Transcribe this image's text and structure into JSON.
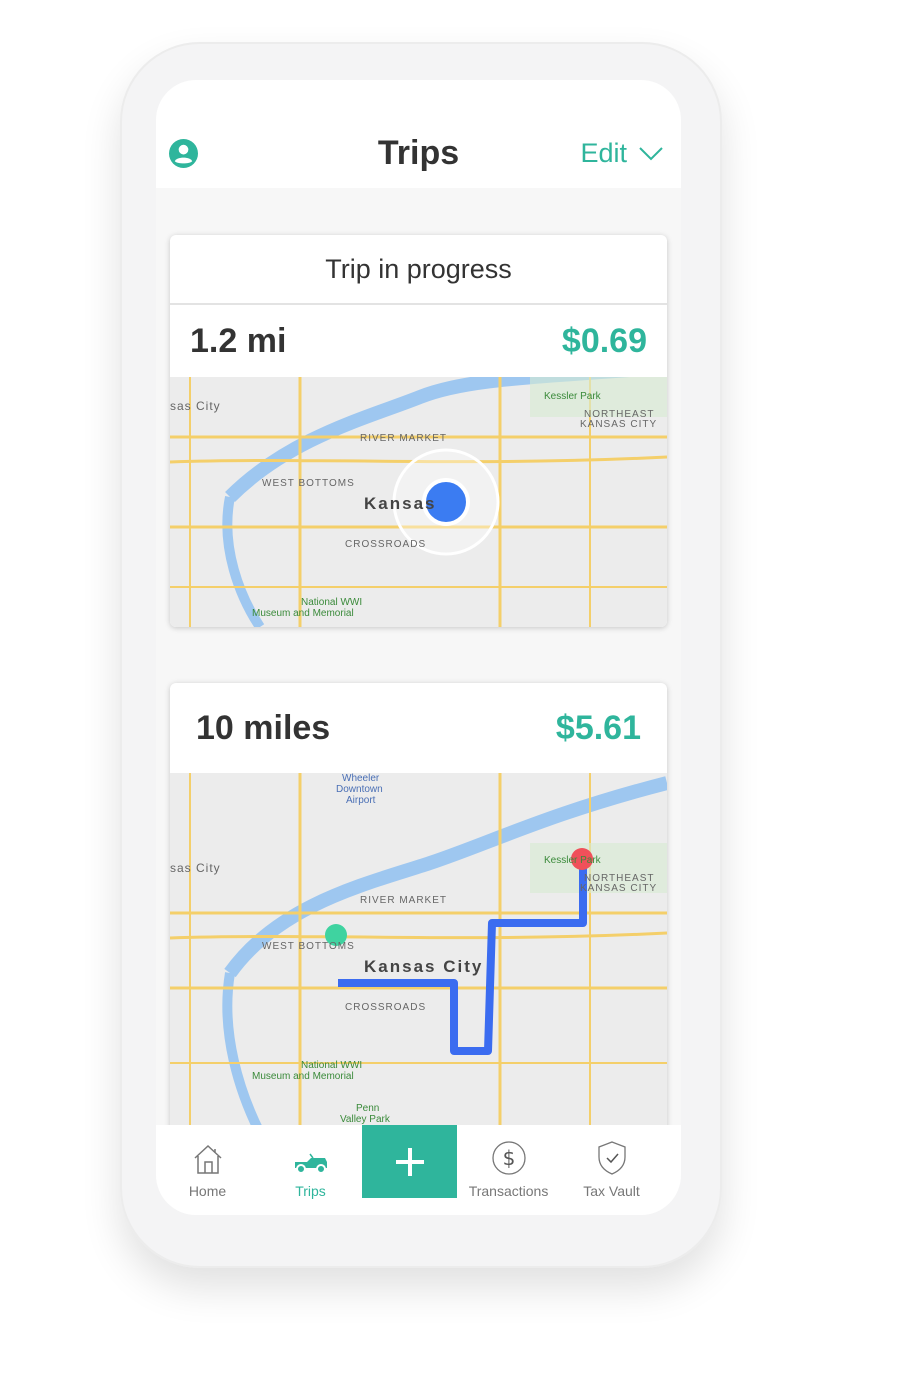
{
  "header": {
    "title": "Trips",
    "edit_label": "Edit"
  },
  "trip_in_progress": {
    "title": "Trip in progress",
    "distance": "1.2 mi",
    "amount": "$0.69",
    "map_labels": [
      "sas City",
      "Kessler Park",
      "NORTHEAST",
      "KANSAS CITY",
      "RIVER MARKET",
      "WEST BOTTOMS",
      "Kansas",
      "CROSSROADS",
      "National WWI",
      "Museum and Memorial"
    ]
  },
  "trip_completed": {
    "distance": "10 miles",
    "amount": "$5.61",
    "map_labels": [
      "sas City",
      "Wheeler",
      "Downtown",
      "Airport",
      "Kessler Park",
      "NORTHEAST",
      "KANSAS CITY",
      "RIVER MARKET",
      "WEST BOTTOMS",
      "Kansas City",
      "CROSSROADS",
      "National WWI",
      "Museum and Memorial",
      "Penn",
      "Valley Park"
    ]
  },
  "tabbar": {
    "items": [
      {
        "label": "Home",
        "icon": "home-icon"
      },
      {
        "label": "Trips",
        "icon": "car-icon",
        "active": true
      },
      {
        "label": "",
        "icon": "plus-icon"
      },
      {
        "label": "Transactions",
        "icon": "dollar-circle-icon"
      },
      {
        "label": "Tax Vault",
        "icon": "shield-check-icon"
      }
    ]
  },
  "colors": {
    "accent": "#2fb59c",
    "location_dot": "#3b7cf2",
    "route": "#3b6cf0",
    "end_pin": "#f0505a"
  }
}
